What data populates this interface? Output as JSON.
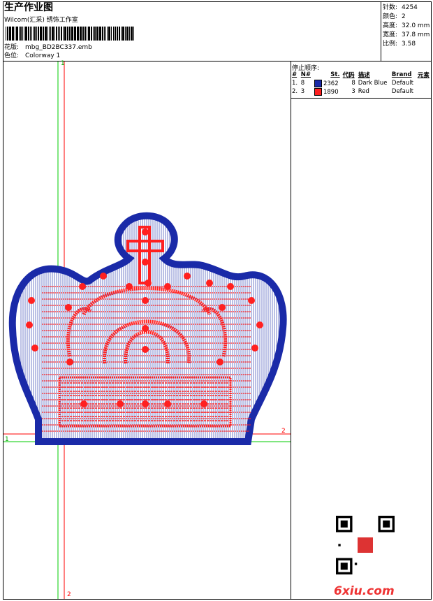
{
  "header": {
    "title": "生产作业图",
    "subtitle": "Wilcom(汇采) 绣饰工作室",
    "design_label": "花版:",
    "design_value": "mbg_BD2BC337.emb",
    "colorway_label": "色位:",
    "colorway_value": "Colorway 1"
  },
  "stats": [
    {
      "label": "针数:",
      "value": "4254"
    },
    {
      "label": "颜色:",
      "value": "2"
    },
    {
      "label": "高度:",
      "value": "32.0 mm"
    },
    {
      "label": "宽度:",
      "value": "37.8 mm"
    },
    {
      "label": "比例:",
      "value": "3.58"
    }
  ],
  "stop_sequence": {
    "label": "停止顺序:",
    "columns": [
      "#",
      "N#",
      "St.",
      "代码",
      "描述",
      "Brand",
      "元素"
    ],
    "rows": [
      {
        "idx": "1.",
        "n": "8",
        "st": "2362",
        "code": "8",
        "desc": "Dark Blue",
        "brand": "Default",
        "color": "#1a2aa8"
      },
      {
        "idx": "2.",
        "n": "3",
        "st": "1890",
        "code": "3",
        "desc": "Red",
        "brand": "Default",
        "color": "#ff2020"
      }
    ]
  },
  "guides": {
    "label_1": "1",
    "label_2": "2"
  },
  "watermark": "6xiu.com",
  "colors": {
    "blue": "#1a2aa8",
    "red": "#ff2020",
    "green_guide": "#00cc00",
    "red_guide": "#ff0000"
  }
}
